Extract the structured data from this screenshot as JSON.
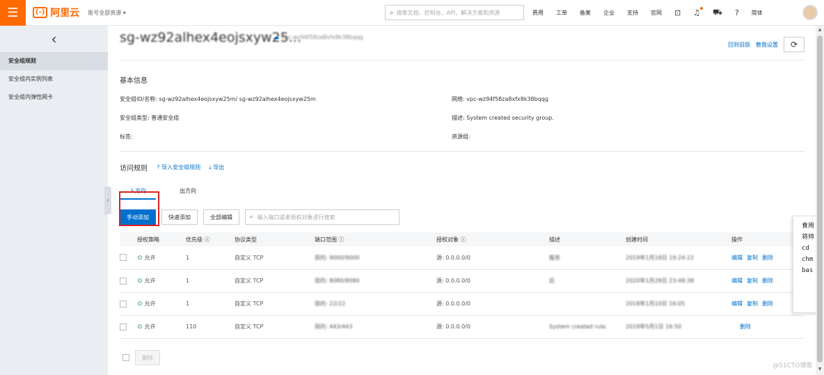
{
  "topbar": {
    "logo_text": "阿里云",
    "logo_mark": "(-)",
    "account_selector": "账号全部资源 ▾",
    "search_placeholder": "搜索文档、控制台、API、解决方案和资源",
    "nav_items": [
      "费用",
      "工单",
      "备案",
      "企业",
      "支持",
      "官网"
    ],
    "lang": "简体"
  },
  "sidebar": {
    "items": [
      {
        "label": "安全组规则",
        "active": true
      },
      {
        "label": "安全组内实例列表",
        "active": false
      },
      {
        "label": "安全组内弹性网卡",
        "active": false
      }
    ]
  },
  "header": {
    "title": "sg-wz92alhex4eojsxyw25...",
    "vpc_short": "vpc-wz94f58za8xfx8k38bqqg",
    "back_old": "回到旧版",
    "tutorial": "教我设置"
  },
  "basic": {
    "title": "基本信息",
    "id_label": "安全组ID/名称:",
    "id_value": "sg-wz92alhex4eojsxyw25m/ sg-wz92alhex4eojsxyw25m",
    "type_label": "安全组类型:",
    "type_value": "普通安全组",
    "tag_label": "标签:",
    "network_label": "网络:",
    "network_value": "vpc-wz94f58za8xfx8k38bqqg",
    "desc_label": "描述:",
    "desc_value": "System created security group.",
    "resgroup_label": "资源组:"
  },
  "rules": {
    "title": "访问规则",
    "import_link": "导入安全组规则",
    "export_link": "导出",
    "tabs": [
      "入方向",
      "出方向"
    ],
    "buttons": {
      "manual_add": "手动添加",
      "quick_add": "快速添加",
      "edit_all": "全部编辑"
    },
    "filter_placeholder": "输入端口或者授权对象进行搜索",
    "columns": [
      "授权策略",
      "优先级 ⓘ",
      "协议类型",
      "端口范围 ⓘ",
      "授权对象 ⓘ",
      "描述",
      "创建时间",
      "操作"
    ],
    "rows": [
      {
        "policy": "允许",
        "priority": "1",
        "protocol": "自定义 TCP",
        "port": "目的: 9000/9000",
        "source": "源: 0.0.0.0/0",
        "desc": "服务",
        "time": "2019年1月18日 19:24:22",
        "ops": [
          "编辑",
          "复制",
          "删除"
        ]
      },
      {
        "policy": "允许",
        "priority": "1",
        "protocol": "自定义 TCP",
        "port": "目的: 8080/8080",
        "source": "源: 0.0.0.0/0",
        "desc": "后",
        "time": "2020年1月28日 23:48:38",
        "ops": [
          "编辑",
          "复制",
          "删除"
        ]
      },
      {
        "policy": "允许",
        "priority": "1",
        "protocol": "自定义 TCP",
        "port": "目的: 22/22",
        "source": "源: 0.0.0.0/0",
        "desc": "",
        "time": "2018年1月10日 16:05",
        "ops": [
          "编辑",
          "复制",
          "删除"
        ]
      },
      {
        "policy": "允许",
        "priority": "110",
        "protocol": "自定义 TCP",
        "port": "目的: 443/443",
        "source": "源: 0.0.0.0/0",
        "desc": "System created rule.",
        "time": "2018年5月1日 16:50",
        "ops": [
          "删除"
        ]
      }
    ],
    "delete_button": "删除"
  },
  "note": {
    "lines": [
      "食用",
      "将帅",
      "cd",
      "chm",
      "bas"
    ]
  },
  "watermark": "@51CTO博客"
}
